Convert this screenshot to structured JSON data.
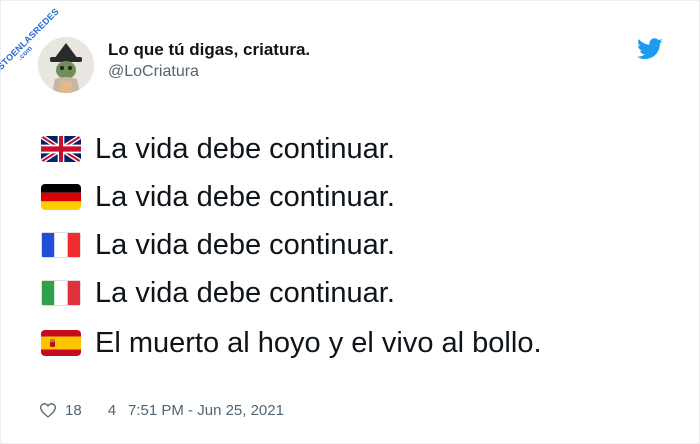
{
  "watermark": {
    "main": "VISTOENLASREDES",
    "sub": ".com"
  },
  "author": {
    "name": "Lo que tú digas, criatura.",
    "handle": "@LoCriatura"
  },
  "lines": [
    {
      "flag": "uk-flag",
      "text": "La vida debe continuar."
    },
    {
      "flag": "germany-flag",
      "text": "La vida debe continuar."
    },
    {
      "flag": "france-flag",
      "text": "La vida debe continuar."
    },
    {
      "flag": "italy-flag",
      "text": "La vida debe continuar."
    },
    {
      "flag": "spain-flag",
      "text": "El muerto al hoyo y el vivo al bollo."
    }
  ],
  "footer": {
    "likes": "18",
    "replies": "4",
    "timestamp": "7:51 PM - Jun 25, 2021"
  },
  "colors": {
    "twitter_blue": "#1d9bf0",
    "secondary_text": "#536471",
    "primary_text": "#0f1419"
  },
  "icons": {
    "brand": "twitter-bird-icon",
    "like": "heart-icon"
  }
}
